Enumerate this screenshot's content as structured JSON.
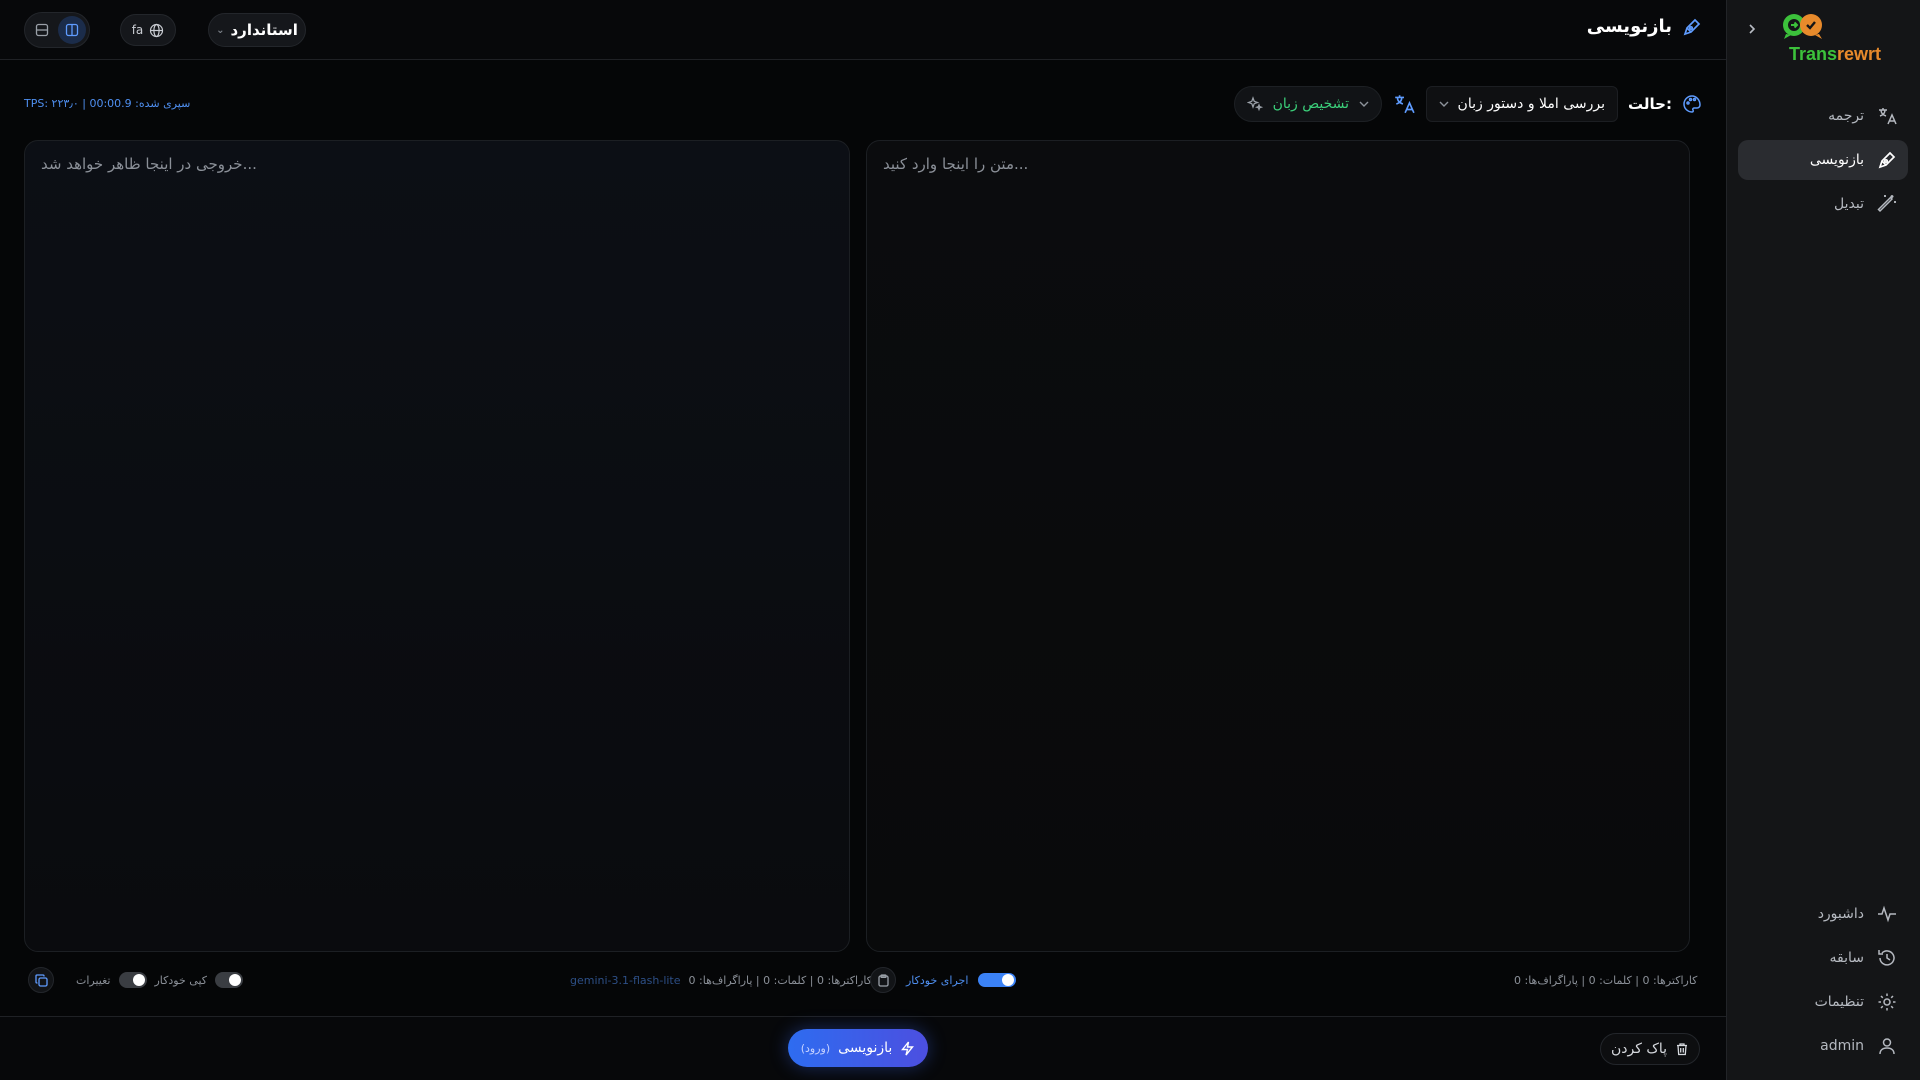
{
  "app": {
    "logo_part1": "Trans",
    "logo_part2": "rewrt",
    "brand_colors": {
      "green": "#3cc13b",
      "orange": "#e88a2b",
      "accent": "#3b82f6"
    }
  },
  "sidebar": {
    "collapse_icon": "chevron-right-icon",
    "top_items": [
      {
        "label": "ترجمه",
        "icon": "translate-icon",
        "active": false
      },
      {
        "label": "بازنویسی",
        "icon": "pen-icon",
        "active": true
      },
      {
        "label": "تبدیل",
        "icon": "magic-wand-icon",
        "active": false
      }
    ],
    "bottom_items": [
      {
        "label": "داشبورد",
        "icon": "activity-icon"
      },
      {
        "label": "سابقه",
        "icon": "history-icon"
      },
      {
        "label": "تنظیمات",
        "icon": "gear-icon"
      },
      {
        "label": "admin",
        "icon": "user-icon"
      }
    ]
  },
  "header": {
    "title": "بازنویسی",
    "mode_selector": "استاندارد",
    "language": "fa"
  },
  "toolbar": {
    "mode_label": "حالت:",
    "mode_value": "بررسی املا و دستور زبان",
    "detect_language": "تشخیص زبان",
    "stats": "TPS: ۲۲۳٫۰ | سپری شده: 00:00.9"
  },
  "input_panel": {
    "placeholder": "...متن را اینجا وارد کنید",
    "counts": "کاراکترها: 0 | کلمات: 0 | پاراگراف‌ها: 0",
    "auto_run_label": "اجرای خودکار",
    "auto_run_on": true
  },
  "output_panel": {
    "placeholder": "...خروجی در اینجا ظاهر خواهد شد",
    "counts": "کاراکترها: 0 | کلمات: 0 | پاراگراف‌ها: 0",
    "model": "gemini-3.1-flash-lite",
    "auto_copy_label": "کپی خودکار",
    "changes_label": "تغییرات"
  },
  "bottom_bar": {
    "run_label": "بازنویسی",
    "run_sub": "(ورود)",
    "clear_label": "پاک کردن"
  }
}
